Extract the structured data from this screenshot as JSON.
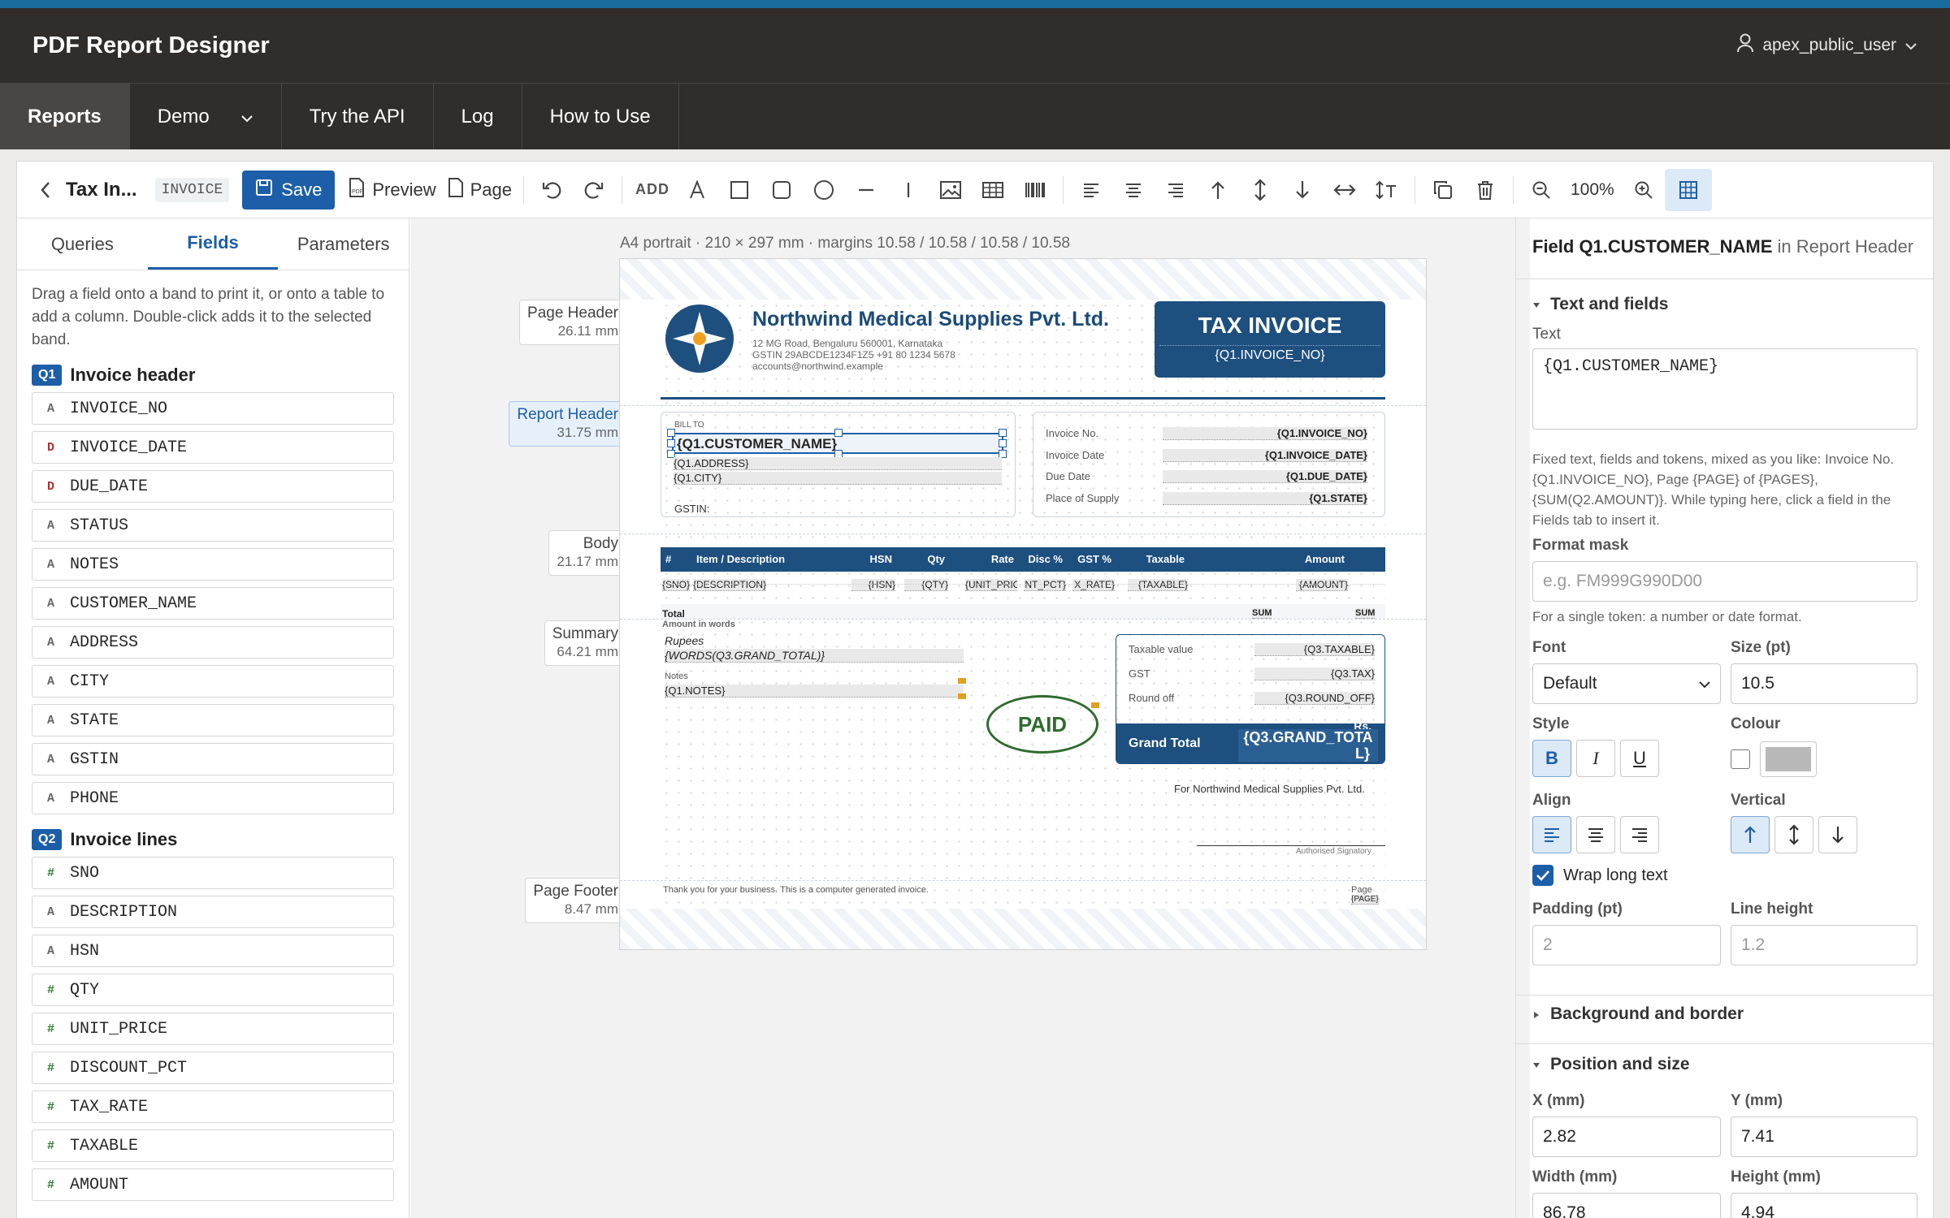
{
  "header": {
    "app_title": "PDF Report Designer",
    "user": "apex_public_user"
  },
  "nav": {
    "items": [
      "Reports",
      "Demo",
      "Try the API",
      "Log",
      "How to Use"
    ]
  },
  "toolbar": {
    "report_title": "Tax In...",
    "report_badge": "INVOICE",
    "save": "Save",
    "preview": "Preview",
    "page": "Page",
    "add": "ADD",
    "zoom": "100%"
  },
  "left": {
    "tabs": [
      "Queries",
      "Fields",
      "Parameters"
    ],
    "help": "Drag a field onto a band to print it, or onto a table to add a column. Double-click adds it to the selected band.",
    "groups": [
      {
        "badge": "Q1",
        "title": "Invoice header",
        "fields": [
          {
            "t": "A",
            "n": "INVOICE_NO"
          },
          {
            "t": "D",
            "n": "INVOICE_DATE"
          },
          {
            "t": "D",
            "n": "DUE_DATE"
          },
          {
            "t": "A",
            "n": "STATUS"
          },
          {
            "t": "A",
            "n": "NOTES"
          },
          {
            "t": "A",
            "n": "CUSTOMER_NAME"
          },
          {
            "t": "A",
            "n": "ADDRESS"
          },
          {
            "t": "A",
            "n": "CITY"
          },
          {
            "t": "A",
            "n": "STATE"
          },
          {
            "t": "A",
            "n": "GSTIN"
          },
          {
            "t": "A",
            "n": "PHONE"
          }
        ]
      },
      {
        "badge": "Q2",
        "title": "Invoice lines",
        "fields": [
          {
            "t": "#",
            "n": "SNO"
          },
          {
            "t": "A",
            "n": "DESCRIPTION"
          },
          {
            "t": "A",
            "n": "HSN"
          },
          {
            "t": "#",
            "n": "QTY"
          },
          {
            "t": "#",
            "n": "UNIT_PRICE"
          },
          {
            "t": "#",
            "n": "DISCOUNT_PCT"
          },
          {
            "t": "#",
            "n": "TAX_RATE"
          },
          {
            "t": "#",
            "n": "TAXABLE"
          },
          {
            "t": "#",
            "n": "AMOUNT"
          }
        ]
      }
    ]
  },
  "canvas": {
    "page_info": "A4 portrait · 210 × 297 mm · margins 10.58 / 10.58 / 10.58 / 10.58",
    "bands": [
      {
        "name": "Page Header",
        "size": "26.11 mm"
      },
      {
        "name": "Report Header",
        "size": "31.75 mm"
      },
      {
        "name": "Body",
        "size": "21.17 mm"
      },
      {
        "name": "Summary",
        "size": "64.21 mm"
      },
      {
        "name": "Page Footer",
        "size": "8.47 mm"
      }
    ]
  },
  "invoice": {
    "company": "Northwind Medical Supplies Pvt. Ltd.",
    "address": "12 MG Road, Bengaluru 560001, Karnataka",
    "gstin_line": "GSTIN 29ABCDE1234F1Z5   +91 80 1234 5678",
    "email": "accounts@northwind.example",
    "tax_invoice": "TAX INVOICE",
    "invoice_no_token": "{Q1.INVOICE_NO}",
    "bill_to": "BILL TO",
    "customer_token": "{Q1.CUSTOMER_NAME}",
    "address_token": "{Q1.ADDRESS}",
    "city_token": "{Q1.CITY}",
    "gstin_label": "GSTIN:",
    "meta": [
      {
        "label": "Invoice No.",
        "value": "{Q1.INVOICE_NO}"
      },
      {
        "label": "Invoice Date",
        "value": "{Q1.INVOICE_DATE}"
      },
      {
        "label": "Due Date",
        "value": "{Q1.DUE_DATE}"
      },
      {
        "label": "Place of Supply",
        "value": "{Q1.STATE}"
      }
    ],
    "table_headers": [
      "#",
      "Item / Description",
      "HSN",
      "Qty",
      "Rate",
      "Disc %",
      "GST %",
      "Taxable",
      "Amount"
    ],
    "table_row": [
      "{SNO}",
      "{DESCRIPTION}",
      "{HSN}",
      "{QTY}",
      "{UNIT_PRICE}",
      "NT_PCT}",
      "X_RATE}",
      "{TAXABLE}",
      "{AMOUNT}"
    ],
    "total": "Total",
    "sum1": "SUM",
    "sum2": "SUM",
    "amount_words_label": "Amount in words",
    "rupees": "Rupees",
    "words_token": "{WORDS(Q3.GRAND_TOTAL)}",
    "notes_label": "Notes",
    "notes_token": "{Q1.NOTES}",
    "paid": "PAID",
    "totals": [
      {
        "label": "Taxable value",
        "value": "{Q3.TAXABLE}"
      },
      {
        "label": "GST",
        "value": "{Q3.TAX}"
      },
      {
        "label": "Round off",
        "value": "{Q3.ROUND_OFF}"
      }
    ],
    "grand_total": "Grand Total",
    "rs": "Rs.",
    "grand_token": "{Q3.GRAND_TOTA",
    "grand_token2": "L}",
    "for_company": "For Northwind Medical Supplies Pvt. Ltd.",
    "signatory": "Authorised Signatory",
    "footer_text": "Thank you for your business. This is a computer generated invoice.",
    "page_label": "Page",
    "page_token": "{PAGE}"
  },
  "right": {
    "field_title": "Field Q1.CUSTOMER_NAME",
    "field_context": "in Report Header",
    "sec_text": "Text and fields",
    "text_label": "Text",
    "text_value": "{Q1.CUSTOMER_NAME}",
    "text_hint": "Fixed text, fields and tokens, mixed as you like: Invoice No. {Q1.INVOICE_NO}, Page {PAGE} of {PAGES}, {SUM(Q2.AMOUNT)}. While typing here, click a field in the Fields tab to insert it.",
    "format_label": "Format mask",
    "format_placeholder": "e.g. FM999G990D00",
    "format_hint": "For a single token: a number or date format.",
    "font_label": "Font",
    "font_value": "Default",
    "size_label": "Size (pt)",
    "size_value": "10.5",
    "style_label": "Style",
    "colour_label": "Colour",
    "align_label": "Align",
    "vertical_label": "Vertical",
    "wrap_label": "Wrap long text",
    "padding_label": "Padding (pt)",
    "padding_value": "2",
    "lineheight_label": "Line height",
    "lineheight_value": "1.2",
    "sec_bg": "Background and border",
    "sec_pos": "Position and size",
    "x_label": "X (mm)",
    "x_value": "2.82",
    "y_label": "Y (mm)",
    "y_value": "7.41",
    "w_label": "Width (mm)",
    "w_value": "86.78",
    "h_label": "Height (mm)",
    "h_value": "4.94"
  },
  "colors": {
    "brand": "#1c5ea8",
    "header_bg": "#312d2a",
    "invoice_blue": "#1d4f7f",
    "paid_green": "#2e6b2e"
  }
}
